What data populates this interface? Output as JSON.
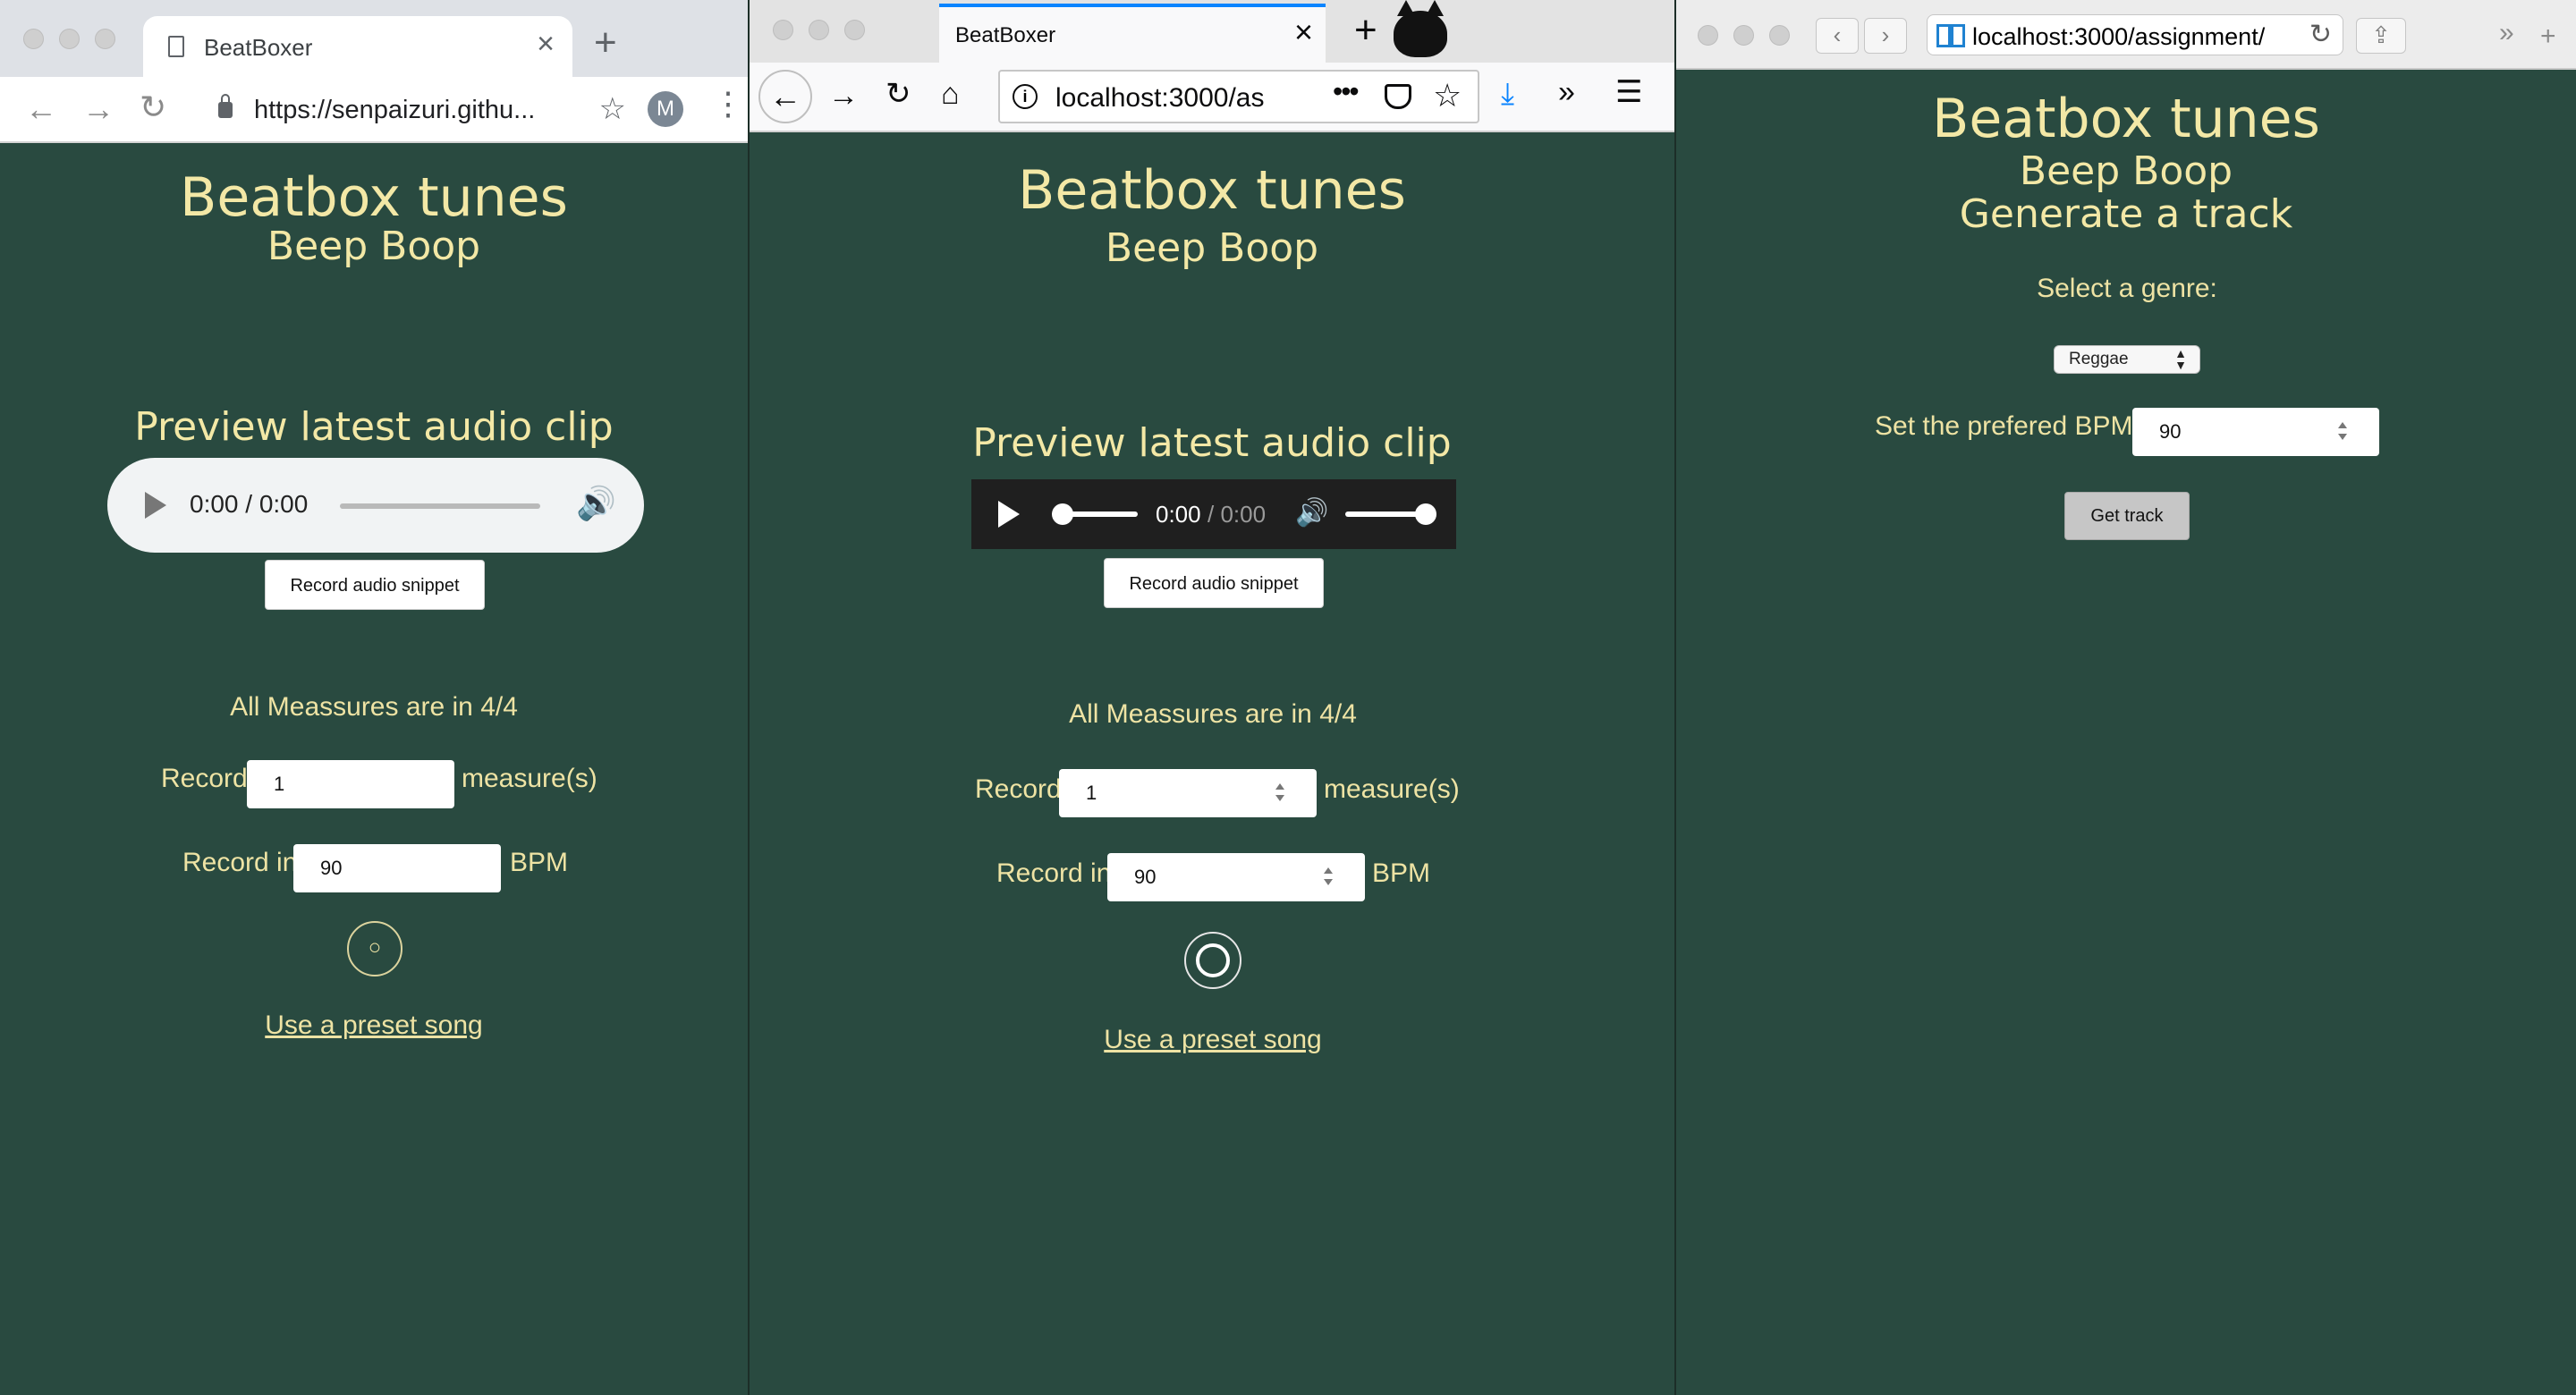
{
  "chrome": {
    "tab_title": "BeatBoxer",
    "url": "https://senpaizuri.githu...",
    "avatar_letter": "M"
  },
  "firefox": {
    "tab_title": "BeatBoxer",
    "url": "localhost:3000/as",
    "dots": "•••"
  },
  "safari": {
    "url": "localhost:3000/assignment/"
  },
  "recorder": {
    "title": "Beatbox tunes",
    "subtitle": "Beep Boop",
    "preview_heading": "Preview latest audio clip",
    "audio_time": "0:00 / 0:00",
    "audio_time_current": "0:00",
    "audio_time_total": "/ 0:00",
    "record_snippet": "Record audio snippet",
    "measures_note": "All Meassures are in 4/4",
    "record_label": "Record",
    "measures_value": "1",
    "measures_suffix": "measure(s)",
    "record_in_label": "Record in",
    "bpm_value": "90",
    "bpm_suffix": "BPM",
    "rec_glyph": "○",
    "preset_link": "Use a preset song"
  },
  "generator": {
    "title": "Beatbox tunes",
    "subtitle": "Beep Boop",
    "heading": "Generate a track",
    "genre_label": "Select a genre:",
    "genre_value": "Reggae",
    "bpm_label": "Set the prefered BPM:",
    "bpm_value": "90",
    "get_track": "Get track"
  },
  "colors": {
    "background": "#294a40",
    "heading": "#f3e8a6"
  }
}
